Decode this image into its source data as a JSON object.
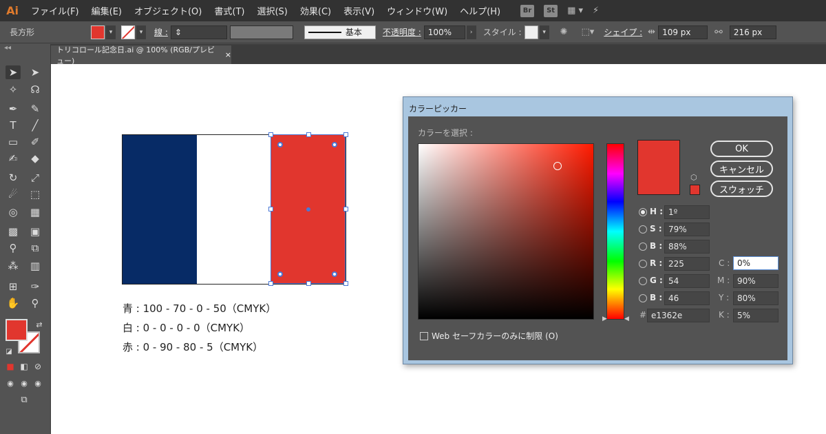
{
  "menubar": {
    "logo": "Ai",
    "items": [
      "ファイル(F)",
      "編集(E)",
      "オブジェクト(O)",
      "書式(T)",
      "選択(S)",
      "効果(C)",
      "表示(V)",
      "ウィンドウ(W)",
      "ヘルプ(H)"
    ],
    "bridge_label": "Br",
    "stock_label": "St",
    "workspace_glyph": "▦ ▾",
    "sync_glyph": "⚡"
  },
  "controlbar": {
    "object_type": "長方形",
    "stroke_label": "線 :",
    "stroke_style": "基本",
    "opacity_label": "不透明度 :",
    "opacity_value": "100%",
    "style_label": "スタイル :",
    "shape_label": "シェイプ :",
    "width_value": "109 px",
    "height_value": "216 px",
    "fill_color": "#e1362e",
    "stroke_color": "#e1362e"
  },
  "tab": {
    "title": "トリコロール記念日.ai @ 100% (RGB/プレビュー)",
    "close": "×"
  },
  "canvas": {
    "captions": [
      "青 : 100 - 70 - 0 - 50（CMYK）",
      "白 : 0 - 0 - 0 - 0（CMYK）",
      "赤 : 0 - 90 - 80 - 5（CMYK）"
    ],
    "flag_colors": [
      "#072b66",
      "#ffffff",
      "#e1362e"
    ]
  },
  "dialog": {
    "title": "カラーピッカー",
    "select_label": "カラーを選択 :",
    "ok": "OK",
    "cancel": "キャンセル",
    "swatches": "スウォッチ",
    "fields": {
      "H": {
        "label": "H :",
        "value": "1º"
      },
      "S": {
        "label": "S :",
        "value": "79%"
      },
      "Bv": {
        "label": "B :",
        "value": "88%"
      },
      "R": {
        "label": "R :",
        "value": "225"
      },
      "G": {
        "label": "G :",
        "value": "54"
      },
      "Bc": {
        "label": "B :",
        "value": "46"
      },
      "hex": {
        "label": "#",
        "value": "e1362e"
      },
      "C": {
        "label": "C :",
        "value": "0%"
      },
      "M": {
        "label": "M :",
        "value": "90%"
      },
      "Y": {
        "label": "Y :",
        "value": "80%"
      },
      "K": {
        "label": "K :",
        "value": "5%"
      }
    },
    "web_safe_label": "Web セーフカラーのみに制限 (O)",
    "new_color": "#e1362e"
  }
}
